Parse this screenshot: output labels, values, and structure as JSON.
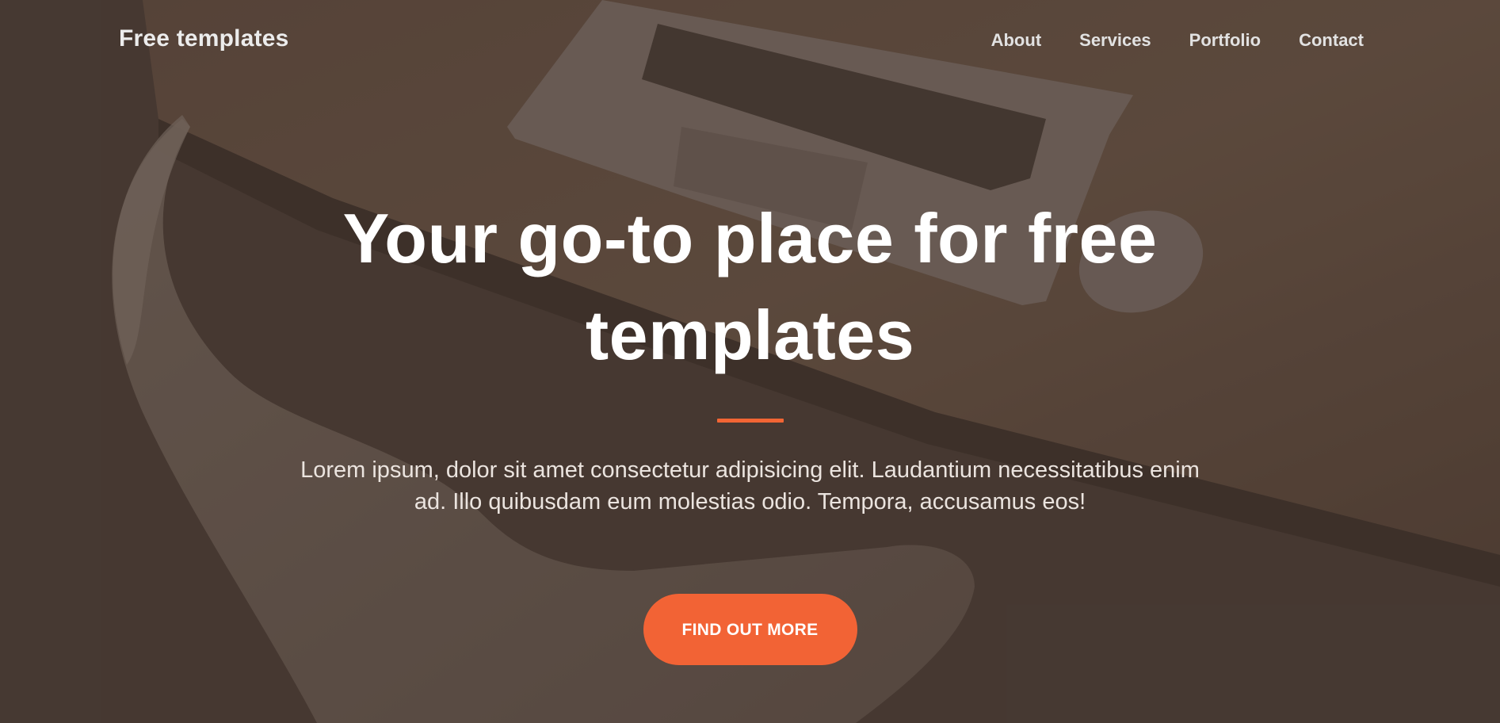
{
  "nav": {
    "brand": "Free templates",
    "links": [
      {
        "label": "About"
      },
      {
        "label": "Services"
      },
      {
        "label": "Portfolio"
      },
      {
        "label": "Contact"
      }
    ]
  },
  "hero": {
    "title": "Your go-to place for free templates",
    "description": "Lorem ipsum, dolor sit amet consectetur adipisicing elit. Laudantium necessitatibus enim ad. Illo quibusdam eum molestias odio. Tempora, accusamus eos!",
    "cta_label": "FIND OUT MORE"
  },
  "colors": {
    "accent": "#f26335",
    "overlay": "#4a3f38",
    "text_light": "#ffffff"
  }
}
